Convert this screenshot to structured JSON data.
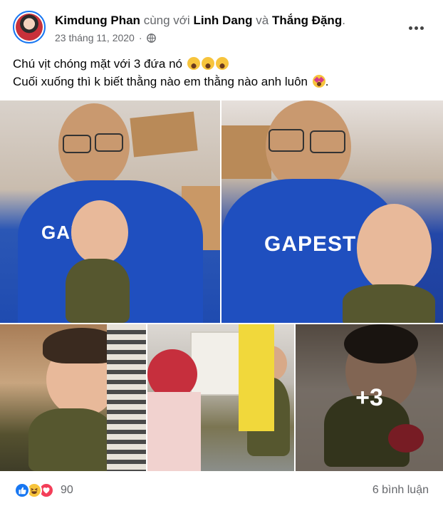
{
  "post": {
    "author": "Kimdung Phan",
    "with_text": "cùng với",
    "tagged": [
      "Linh Dang",
      "Thắng Đặng"
    ],
    "and_text": "và",
    "period": ".",
    "date": "23 tháng 11, 2020",
    "dot": "·",
    "privacy_icon": "globe-icon",
    "more_icon": "more-horizontal-icon",
    "line1": "Chú vịt chóng mặt với 3 đứa nó",
    "line2": "Cuối xuống thì k biết thằng nào em thằng nào anh luôn",
    "line2_end": ".",
    "line1_emojis": [
      "laughing-crying-emoji",
      "laughing-crying-emoji",
      "laughing-crying-emoji"
    ],
    "line2_emoji": "star-struck-emoji"
  },
  "photos": {
    "shirt_text_1": "GAP",
    "shirt_text_2": "GAPEST",
    "more_count": "+3"
  },
  "footer": {
    "reaction_icons": [
      "like-icon",
      "haha-icon",
      "love-icon"
    ],
    "reaction_count": "90",
    "comments": "6 bình luận"
  },
  "colors": {
    "accent": "#1877f2",
    "muted": "#65676b",
    "love": "#f33e58",
    "haha": "#f7c43c"
  }
}
